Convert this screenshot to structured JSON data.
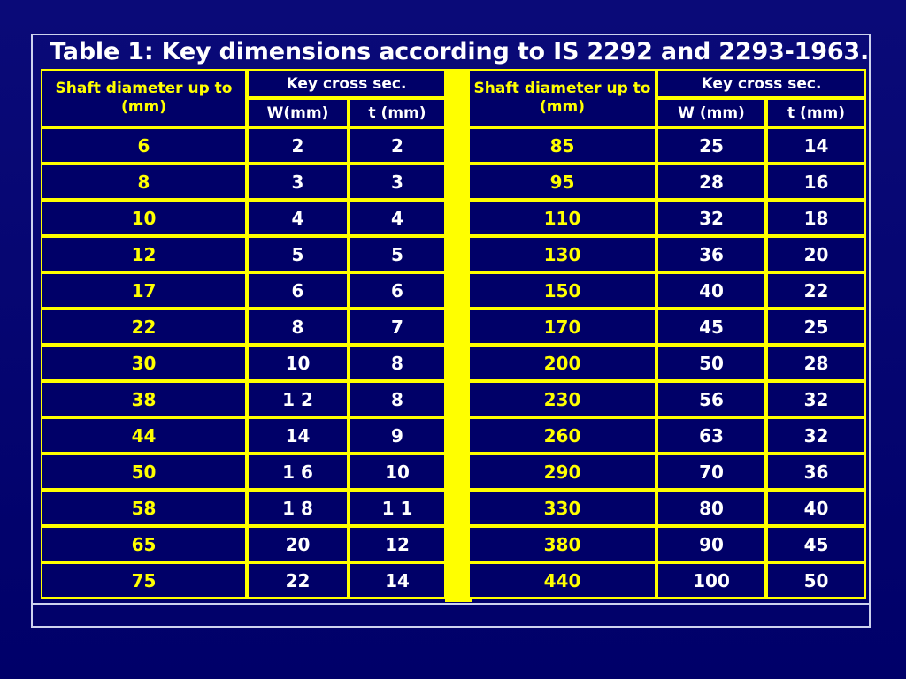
{
  "slide": {
    "title": "Table 1: Key dimensions according to IS 2292 and 2293-1963.",
    "background_color": "#000080",
    "frame_color": "#cdd2ee",
    "grid_color": "#ffff00",
    "cell_background": "#000068",
    "diameter_text_color": "#ffff00",
    "value_text_color": "#ffffff"
  },
  "left_table": {
    "headers": {
      "shaft": "Shaft diameter up to (mm)",
      "cross_section": "Key cross sec.",
      "w": "W(mm)",
      "t": "t (mm)"
    },
    "rows": [
      {
        "dia": "6",
        "w": "2",
        "t": "2"
      },
      {
        "dia": "8",
        "w": "3",
        "t": "3"
      },
      {
        "dia": "10",
        "w": "4",
        "t": "4"
      },
      {
        "dia": "12",
        "w": "5",
        "t": "5"
      },
      {
        "dia": "17",
        "w": "6",
        "t": "6"
      },
      {
        "dia": "22",
        "w": "8",
        "t": "7"
      },
      {
        "dia": "30",
        "w": "10",
        "t": "8"
      },
      {
        "dia": "38",
        "w": "1 2",
        "t": "8"
      },
      {
        "dia": "44",
        "w": "14",
        "t": "9"
      },
      {
        "dia": "50",
        "w": "1 6",
        "t": "10"
      },
      {
        "dia": "58",
        "w": "1 8",
        "t": "1 1"
      },
      {
        "dia": "65",
        "w": "20",
        "t": "12"
      },
      {
        "dia": "75",
        "w": "22",
        "t": "14"
      }
    ]
  },
  "right_table": {
    "headers": {
      "shaft": "Shaft diameter up to (mm)",
      "cross_section": "Key cross sec.",
      "w": "W (mm)",
      "t": "t (mm)"
    },
    "rows": [
      {
        "dia": "85",
        "w": "25",
        "t": "14"
      },
      {
        "dia": "95",
        "w": "28",
        "t": "16"
      },
      {
        "dia": "110",
        "w": "32",
        "t": "18"
      },
      {
        "dia": "130",
        "w": "36",
        "t": "20"
      },
      {
        "dia": "150",
        "w": "40",
        "t": "22"
      },
      {
        "dia": "170",
        "w": "45",
        "t": "25"
      },
      {
        "dia": "200",
        "w": "50",
        "t": "28"
      },
      {
        "dia": "230",
        "w": "56",
        "t": "32"
      },
      {
        "dia": "260",
        "w": "63",
        "t": "32"
      },
      {
        "dia": "290",
        "w": "70",
        "t": "36"
      },
      {
        "dia": "330",
        "w": "80",
        "t": "40"
      },
      {
        "dia": "380",
        "w": "90",
        "t": "45"
      },
      {
        "dia": "440",
        "w": "100",
        "t": "50"
      }
    ]
  }
}
